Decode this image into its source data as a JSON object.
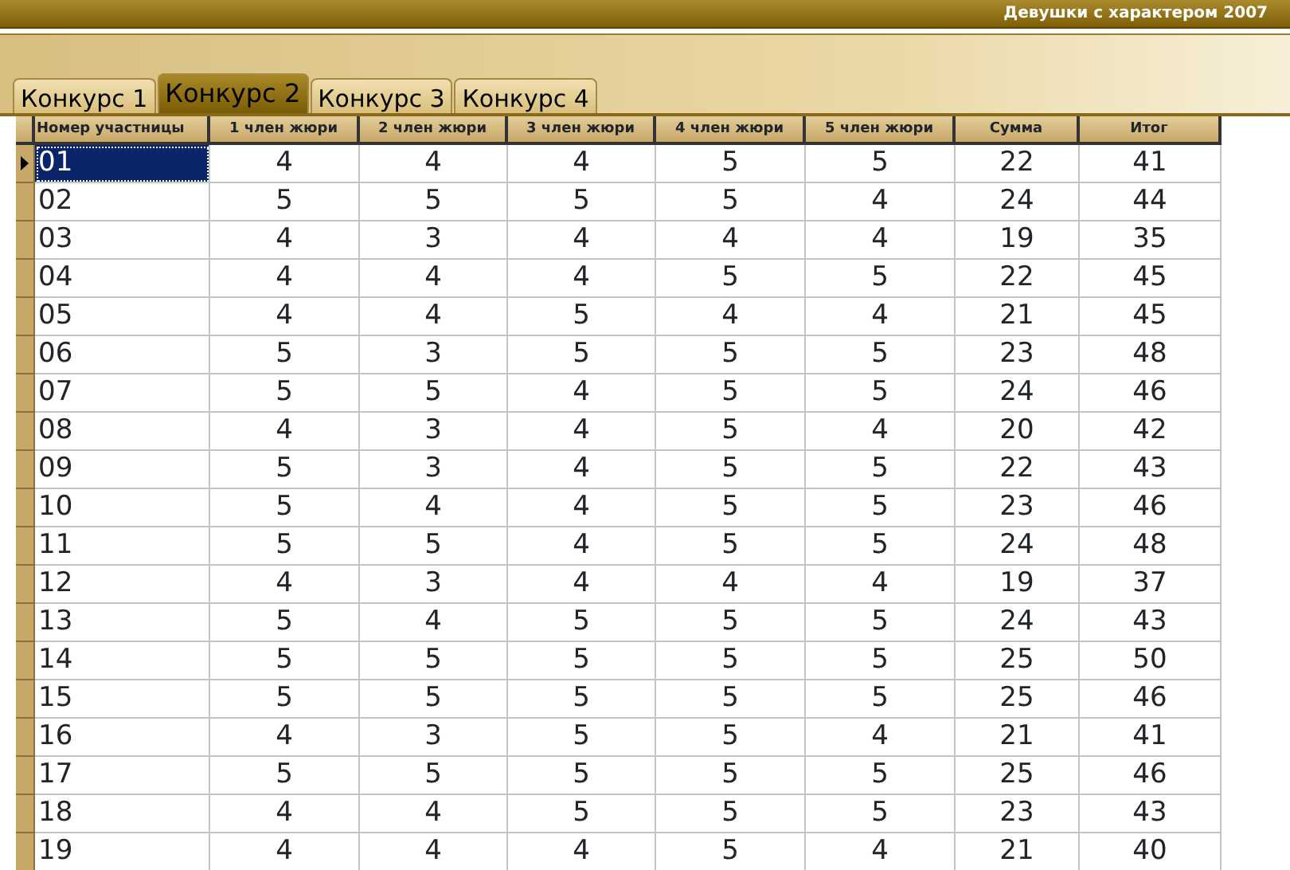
{
  "window": {
    "title": "Девушки с характером 2007"
  },
  "tabs": [
    {
      "label": "Конкурс 1",
      "selected": false
    },
    {
      "label": "Конкурс 2",
      "selected": true
    },
    {
      "label": "Конкурс 3",
      "selected": false
    },
    {
      "label": "Конкурс 4",
      "selected": false
    }
  ],
  "table": {
    "columns": [
      "Номер участницы",
      "1 член жюри",
      "2 член жюри",
      "3 член жюри",
      "4 член жюри",
      "5 член жюри",
      "Сумма",
      "Итог"
    ],
    "rows": [
      {
        "selected": true,
        "cells": [
          "01",
          "4",
          "4",
          "4",
          "5",
          "5",
          "22",
          "41"
        ]
      },
      {
        "selected": false,
        "cells": [
          "02",
          "5",
          "5",
          "5",
          "5",
          "4",
          "24",
          "44"
        ]
      },
      {
        "selected": false,
        "cells": [
          "03",
          "4",
          "3",
          "4",
          "4",
          "4",
          "19",
          "35"
        ]
      },
      {
        "selected": false,
        "cells": [
          "04",
          "4",
          "4",
          "4",
          "5",
          "5",
          "22",
          "45"
        ]
      },
      {
        "selected": false,
        "cells": [
          "05",
          "4",
          "4",
          "5",
          "4",
          "4",
          "21",
          "45"
        ]
      },
      {
        "selected": false,
        "cells": [
          "06",
          "5",
          "3",
          "5",
          "5",
          "5",
          "23",
          "48"
        ]
      },
      {
        "selected": false,
        "cells": [
          "07",
          "5",
          "5",
          "4",
          "5",
          "5",
          "24",
          "46"
        ]
      },
      {
        "selected": false,
        "cells": [
          "08",
          "4",
          "3",
          "4",
          "5",
          "4",
          "20",
          "42"
        ]
      },
      {
        "selected": false,
        "cells": [
          "09",
          "5",
          "3",
          "4",
          "5",
          "5",
          "22",
          "43"
        ]
      },
      {
        "selected": false,
        "cells": [
          "10",
          "5",
          "4",
          "4",
          "5",
          "5",
          "23",
          "46"
        ]
      },
      {
        "selected": false,
        "cells": [
          "11",
          "5",
          "5",
          "4",
          "5",
          "5",
          "24",
          "48"
        ]
      },
      {
        "selected": false,
        "cells": [
          "12",
          "4",
          "3",
          "4",
          "4",
          "4",
          "19",
          "37"
        ]
      },
      {
        "selected": false,
        "cells": [
          "13",
          "5",
          "4",
          "5",
          "5",
          "5",
          "24",
          "43"
        ]
      },
      {
        "selected": false,
        "cells": [
          "14",
          "5",
          "5",
          "5",
          "5",
          "5",
          "25",
          "50"
        ]
      },
      {
        "selected": false,
        "cells": [
          "15",
          "5",
          "5",
          "5",
          "5",
          "5",
          "25",
          "46"
        ]
      },
      {
        "selected": false,
        "cells": [
          "16",
          "4",
          "3",
          "5",
          "5",
          "4",
          "21",
          "41"
        ]
      },
      {
        "selected": false,
        "cells": [
          "17",
          "5",
          "5",
          "5",
          "5",
          "5",
          "25",
          "46"
        ]
      },
      {
        "selected": false,
        "cells": [
          "18",
          "4",
          "4",
          "5",
          "5",
          "5",
          "23",
          "43"
        ]
      },
      {
        "selected": false,
        "cells": [
          "19",
          "4",
          "4",
          "4",
          "5",
          "4",
          "21",
          "40"
        ]
      }
    ]
  }
}
